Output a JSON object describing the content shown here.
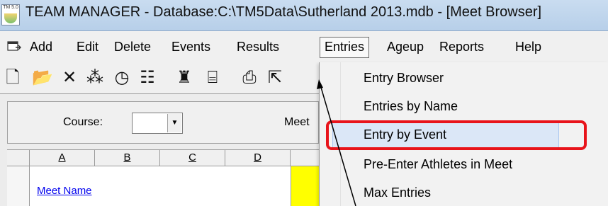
{
  "window": {
    "title": "TEAM MANAGER - Database:C:\\TM5Data\\Sutherland 2013.mdb - [Meet Browser]",
    "icon_text": "TM 5.0"
  },
  "menubar": {
    "items": [
      {
        "label": "Add"
      },
      {
        "label": "Edit"
      },
      {
        "label": "Delete"
      },
      {
        "label": "Events"
      },
      {
        "label": "Results"
      },
      {
        "label": "Entries"
      },
      {
        "label": "Ageup"
      },
      {
        "label": "Reports"
      },
      {
        "label": "Help"
      }
    ],
    "active_item": "Entries"
  },
  "toolbar": {
    "icons": [
      "new-document-icon",
      "open-folder-icon",
      "delete-x-icon",
      "team-icon",
      "clock-icon",
      "list-icon",
      "athlete-icon",
      "calendar-icon",
      "print-icon",
      "export-icon"
    ],
    "glyphs": [
      "🗋",
      "📂",
      "✕",
      "⁂",
      "◷",
      "☷",
      "♜",
      "⌸",
      "⎙",
      "⇱"
    ]
  },
  "filters": {
    "course_label": "Course:",
    "course_value": "",
    "meet_label": "Meet"
  },
  "grid": {
    "columns": [
      "A",
      "B",
      "C",
      "D"
    ],
    "first_row_link": "Meet Name"
  },
  "entries_menu": {
    "items": [
      {
        "label": "Entry Browser"
      },
      {
        "label": "Entries by Name"
      },
      {
        "label": "Entry by Event"
      },
      {
        "label": "Pre-Enter Athletes in Meet"
      },
      {
        "label": "Max Entries"
      }
    ],
    "highlighted": "Entry by Event"
  },
  "colors": {
    "annotation_red": "#e8141b",
    "hover_blue": "#dbe7f7",
    "link_blue": "#0000ee",
    "cell_yellow": "#ffff00"
  }
}
